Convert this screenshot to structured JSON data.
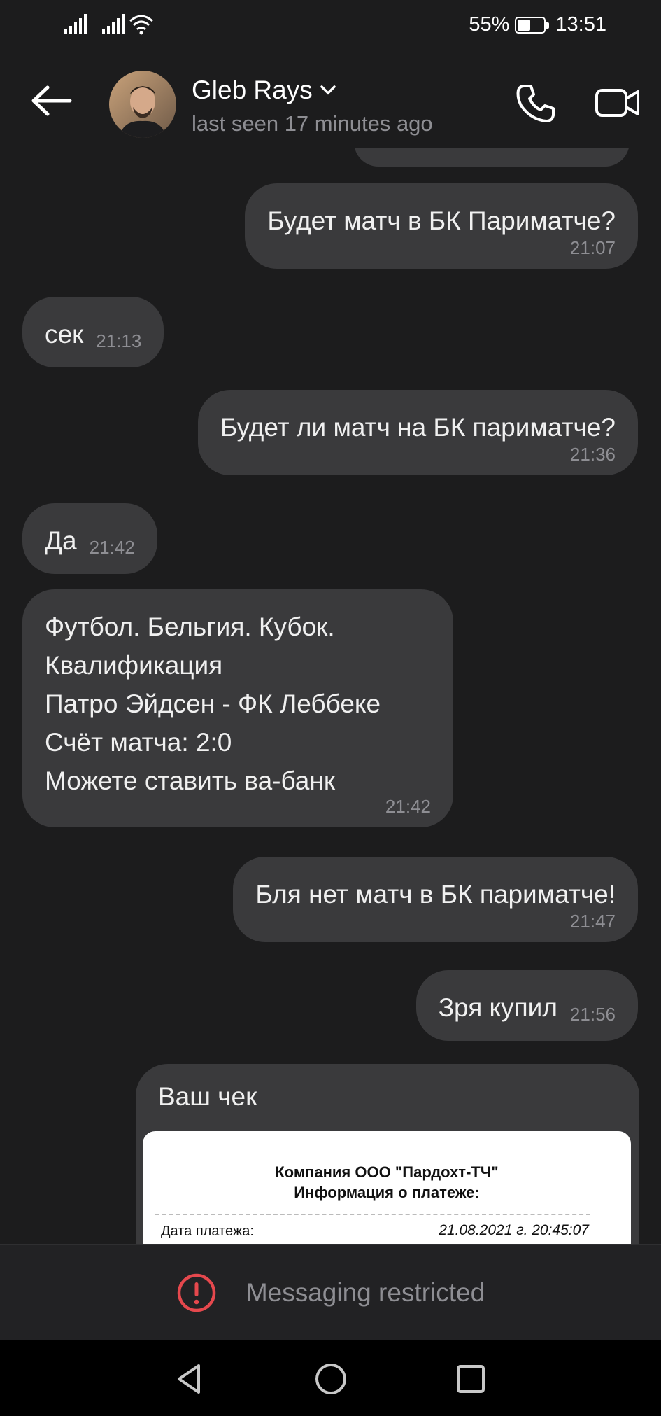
{
  "status_bar": {
    "battery": "55%",
    "battery_level": 0.55,
    "time": "13:51",
    "icons": [
      "signal-icon",
      "signal-icon",
      "wifi-icon",
      "battery-icon"
    ]
  },
  "header": {
    "contact_name": "Gleb Rays",
    "last_seen": "last seen 17 minutes ago",
    "icons": [
      "back-arrow-icon",
      "chevron-down-icon",
      "phone-icon",
      "video-icon"
    ]
  },
  "messages": [
    {
      "direction": "out",
      "text": "Будет матч в БК Париматче?",
      "time": "21:07"
    },
    {
      "direction": "in",
      "text": "сек",
      "time": "21:13"
    },
    {
      "direction": "out",
      "text": "Будет ли матч на БК париматче?",
      "time": "21:36"
    },
    {
      "direction": "in",
      "text": "Да",
      "time": "21:42"
    },
    {
      "direction": "in",
      "text": "Футбол. Бельгия. Кубок.\nКвалификация\nПатро Эйдсен - ФК Леббеке\nСчёт матча: 2:0\nМожете ставить ва-банк",
      "time": "21:42"
    },
    {
      "direction": "out",
      "text": "Бля нет матч в БК париматче!",
      "time": "21:47"
    },
    {
      "direction": "out",
      "text": "Зря купил",
      "time": "21:56"
    }
  ],
  "receipt": {
    "title": "Ваш чек",
    "company": "Компания ООО \"Пардохт-ТЧ\"",
    "info": "Информация о платеже:",
    "date_label": "Дата платежа:",
    "date_value": "21.08.2021 г. 20:45:07"
  },
  "footer": {
    "restricted": "Messaging restricted",
    "icon": "alert-circle-icon",
    "accent": "#e5484d"
  },
  "navbar": {
    "icons": [
      "nav-back-icon",
      "nav-home-icon",
      "nav-recents-icon"
    ]
  }
}
